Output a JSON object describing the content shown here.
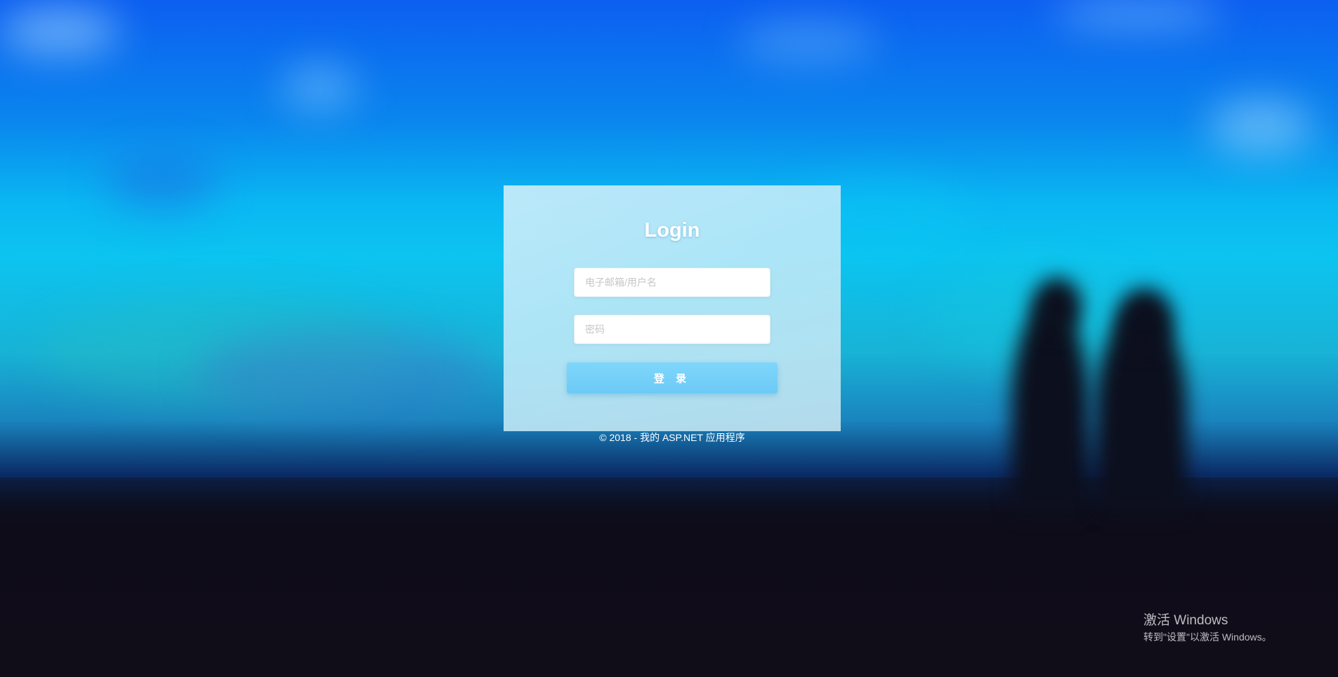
{
  "login": {
    "title": "Login",
    "username_placeholder": "电子邮箱/用户名",
    "password_placeholder": "密码",
    "submit_label": "登 录"
  },
  "footer": {
    "text": "© 2018 - 我的 ASP.NET 应用程序"
  },
  "windows_watermark": {
    "title": "激活 Windows",
    "subtitle": "转到\"设置\"以激活 Windows。"
  },
  "colors": {
    "button": "#74d0f8",
    "card": "#c4ecfa",
    "title_text": "#ffffff"
  }
}
